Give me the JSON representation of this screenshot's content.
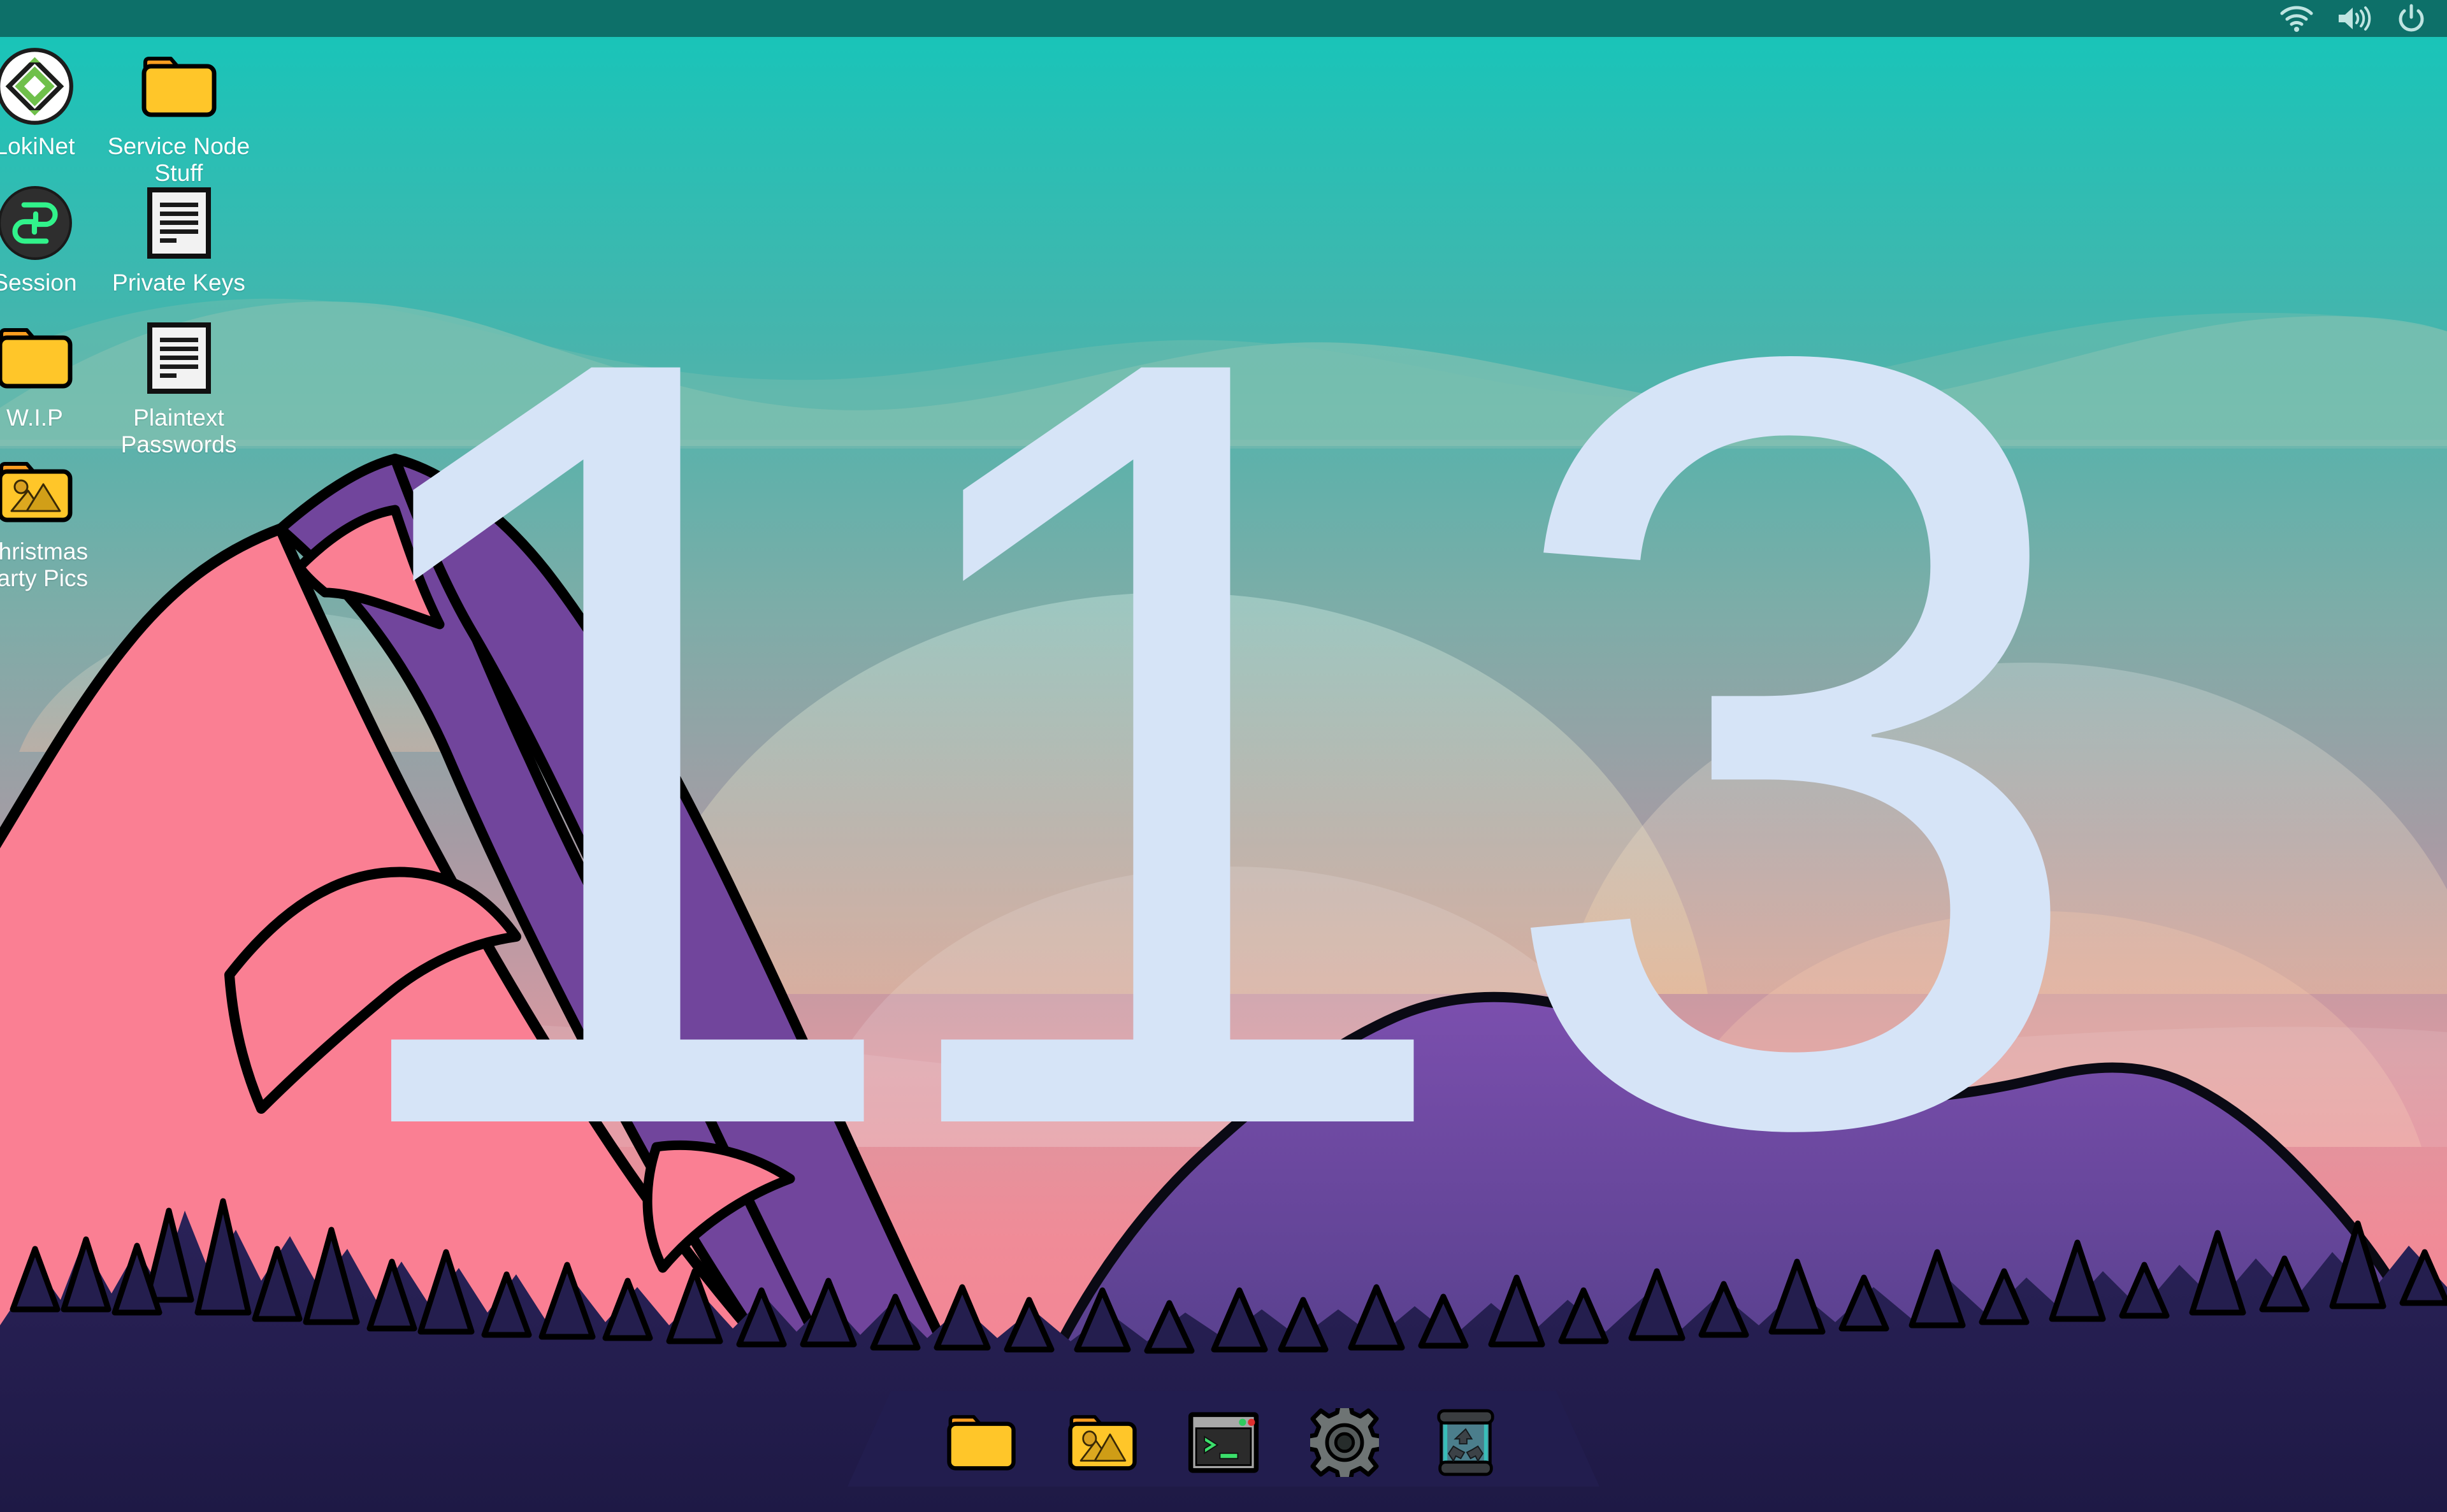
{
  "desktop": {
    "wallpaper": {
      "number_text": "113",
      "number_color": "#d6e4f7",
      "sky_top_color": "#12c4b8",
      "sky_mid_color": "#7fb0ad",
      "sky_rose_color": "#e08a95",
      "forest_color": "#241e4e",
      "mountain_pink": "#fa7f93",
      "mountain_purple": "#71459c",
      "outline_color": "#000000"
    },
    "icons": [
      {
        "label": "LokiNet",
        "icon": "lokinet-logo-icon",
        "col": 0,
        "row": 0
      },
      {
        "label": "Service Node Stuff",
        "icon": "folder-icon",
        "col": 1,
        "row": 0
      },
      {
        "label": "Session",
        "icon": "session-logo-icon",
        "col": 0,
        "row": 1
      },
      {
        "label": "Private Keys",
        "icon": "document-icon",
        "col": 1,
        "row": 1
      },
      {
        "label": "W.I.P",
        "icon": "folder-icon",
        "col": 0,
        "row": 2
      },
      {
        "label": "Plaintext Passwords",
        "icon": "document-icon",
        "col": 1,
        "row": 2
      },
      {
        "label": "Christmas Party Pics",
        "icon": "folder-pictures-icon",
        "col": 0,
        "row": 3
      }
    ]
  },
  "topbar": {
    "background": "#0d7069",
    "tray": [
      {
        "name": "wifi-icon",
        "title": "Network"
      },
      {
        "name": "volume-icon",
        "title": "Volume"
      },
      {
        "name": "power-icon",
        "title": "Power"
      }
    ]
  },
  "dock": {
    "background": "#231d4f",
    "items": [
      {
        "name": "file-manager",
        "icon": "folder-icon",
        "title": "Files"
      },
      {
        "name": "image-viewer",
        "icon": "folder-pictures-icon",
        "title": "Pictures"
      },
      {
        "name": "terminal",
        "icon": "terminal-icon",
        "title": "Terminal"
      },
      {
        "name": "settings",
        "icon": "gear-icon",
        "title": "Settings"
      },
      {
        "name": "trash",
        "icon": "trash-recycle-icon",
        "title": "Trash"
      }
    ]
  },
  "colors": {
    "folder_body": "#ffc629",
    "folder_tab": "#fb9d20",
    "document_paper": "#f2f2f2",
    "document_lines": "#1a1a1a",
    "session_bg": "#2e2e2e",
    "session_green": "#31f38b",
    "lokinet_green": "#6fc04b",
    "lokinet_dark": "#1c1c1c",
    "terminal_green": "#3bdf6b",
    "gear_gray": "#6e7474",
    "trash_teal": "#4f8792"
  }
}
